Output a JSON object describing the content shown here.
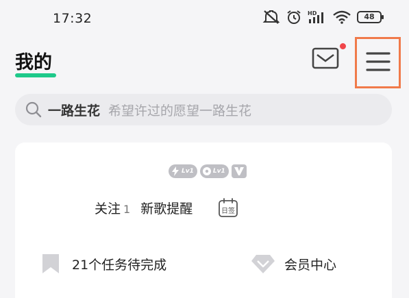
{
  "status_bar": {
    "time": "17:32",
    "battery": "48",
    "icons": [
      "mute-icon",
      "alarm-icon",
      "hd-signal-icon",
      "wifi-icon",
      "battery-icon"
    ]
  },
  "header": {
    "title": "我的",
    "accent_color": "#1ec98a",
    "mail_unread_dot_color": "#f0454a"
  },
  "search": {
    "keyword": "一路生花",
    "hint": "希望许过的愿望一路生花"
  },
  "profile_card": {
    "badges": [
      {
        "icon": "lightning-icon",
        "level": "Lv1"
      },
      {
        "icon": "record-icon",
        "level": "Lv1"
      },
      {
        "icon": "v-badge-icon"
      }
    ],
    "follow_label": "关注",
    "follow_count": "1",
    "new_song_label": "新歌提醒",
    "checkin_label": "日签",
    "task_label": "21个任务待完成",
    "vip_label": "会员中心"
  }
}
